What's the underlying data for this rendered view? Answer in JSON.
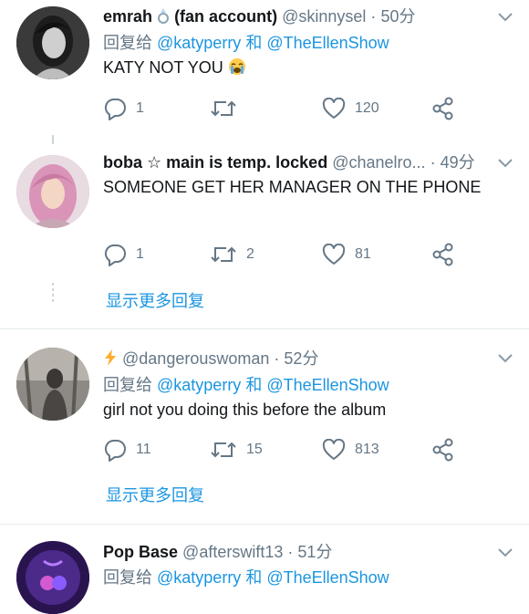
{
  "tweets": [
    {
      "name": "emrah",
      "name_suffix": "(fan account)",
      "handle": "@skinnysel",
      "time": "50分",
      "reply_prefix": "回复给",
      "mention1": "@katyperry",
      "and": "和",
      "mention2": "@TheEllenShow",
      "text": "KATY NOT YOU",
      "replies": "1",
      "retweets": "",
      "likes": "120"
    },
    {
      "name": "boba ☆ main is temp. locked",
      "handle": "@chanelro...",
      "time": "49分",
      "text": "SOMEONE GET HER MANAGER ON THE PHONE",
      "replies": "1",
      "retweets": "2",
      "likes": "81"
    },
    {
      "name": "⚡",
      "handle": "@dangerouswoman",
      "time": "52分",
      "reply_prefix": "回复给",
      "mention1": "@katyperry",
      "and": "和",
      "mention2": "@TheEllenShow",
      "text": "girl not you doing this before the album",
      "replies": "11",
      "retweets": "15",
      "likes": "813"
    },
    {
      "name": "Pop Base",
      "handle": "@afterswift13",
      "time": "51分",
      "reply_prefix": "回复给",
      "mention1": "@katyperry",
      "and": "和",
      "mention2": "@TheEllenShow"
    }
  ],
  "show_more_label": "显示更多回复",
  "colors": {
    "link": "#1b95e0",
    "muted": "#657786",
    "text": "#14171a",
    "divider": "#e6ecf0"
  },
  "icons": [
    "reply-icon",
    "retweet-icon",
    "like-icon",
    "share-icon",
    "chevron-down-icon",
    "ring-emoji-icon",
    "crying-emoji-icon",
    "star-icon",
    "lightning-icon"
  ]
}
